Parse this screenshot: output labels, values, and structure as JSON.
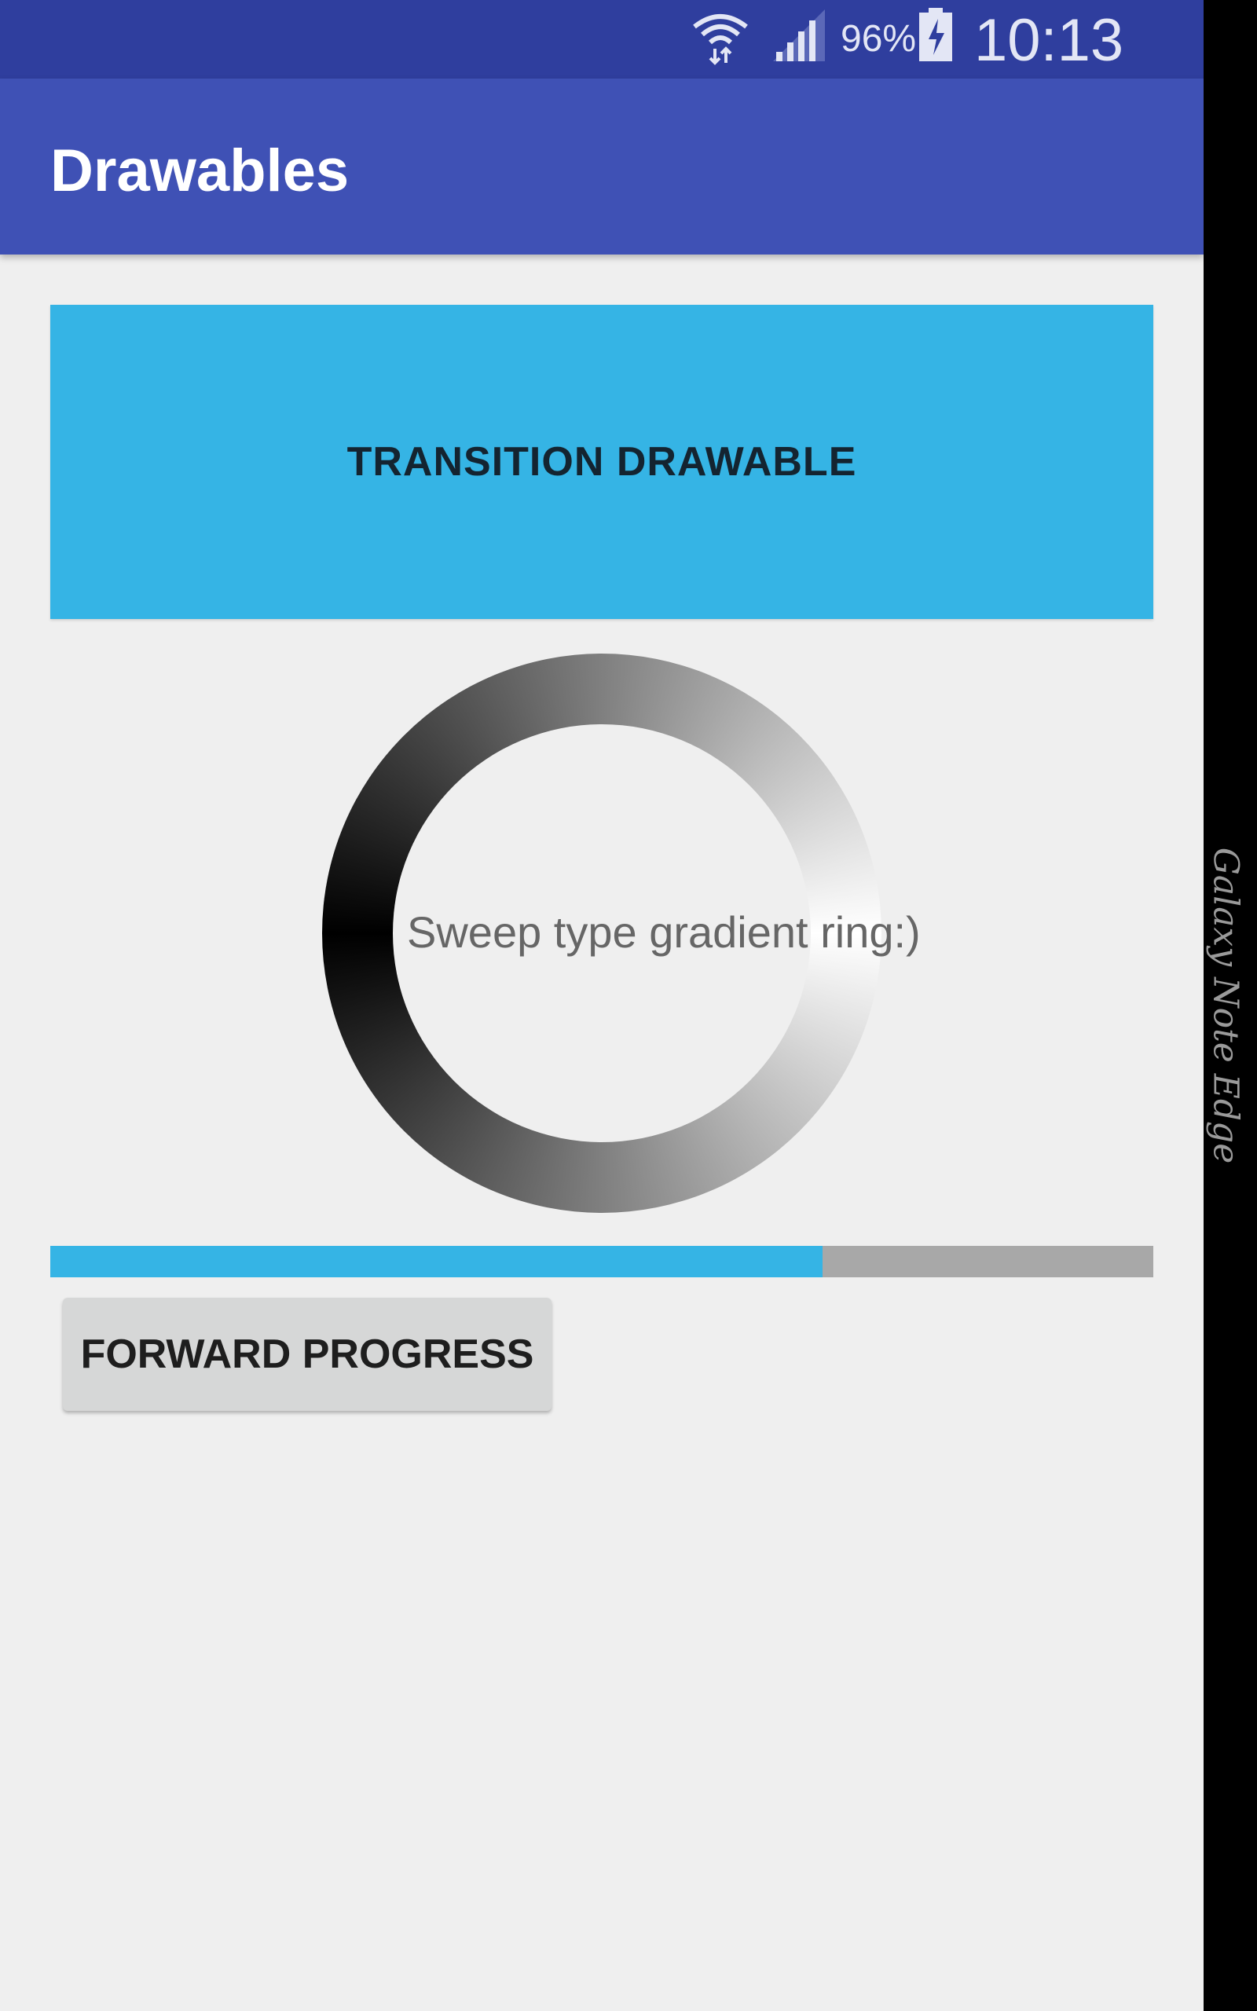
{
  "status_bar": {
    "icons": [
      "wifi-icon",
      "signal-icon",
      "battery-charging-icon"
    ],
    "battery_percent": "96%",
    "time": "10:13"
  },
  "app_bar": {
    "title": "Drawables",
    "color": "#3f51b5"
  },
  "transition_drawable": {
    "label": "TRANSITION DRAWABLE",
    "color": "#35b4e5"
  },
  "gradient_ring": {
    "label": "Sweep type gradient ring:)",
    "gradient": "sweep",
    "colors": [
      "#000000",
      "#ffffff"
    ]
  },
  "progress": {
    "value": 0.7,
    "fill_color": "#35b4e5",
    "track_color": "#a8a8a8"
  },
  "forward_button": {
    "label": "FORWARD PROGRESS"
  },
  "edge_screen": {
    "text": "Galaxy Note Edge"
  }
}
